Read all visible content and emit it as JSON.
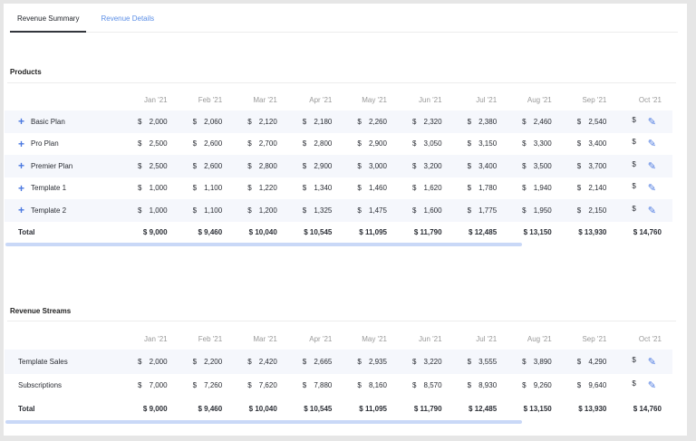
{
  "tabs": [
    {
      "label": "Revenue Summary",
      "active": true
    },
    {
      "label": "Revenue Details",
      "active": false
    }
  ],
  "months": [
    "Jan '21",
    "Feb '21",
    "Mar '21",
    "Apr '21",
    "May '21",
    "Jun '21",
    "Jul '21",
    "Aug '21",
    "Sep '21",
    "Oct '21"
  ],
  "currency": "$",
  "products": {
    "title": "Products",
    "rows": [
      {
        "label": "Basic Plan",
        "values": [
          "2,000",
          "2,060",
          "2,120",
          "2,180",
          "2,260",
          "2,320",
          "2,380",
          "2,460",
          "2,540"
        ]
      },
      {
        "label": "Pro Plan",
        "values": [
          "2,500",
          "2,600",
          "2,700",
          "2,800",
          "2,900",
          "3,050",
          "3,150",
          "3,300",
          "3,400"
        ]
      },
      {
        "label": "Premier Plan",
        "values": [
          "2,500",
          "2,600",
          "2,800",
          "2,900",
          "3,000",
          "3,200",
          "3,400",
          "3,500",
          "3,700"
        ]
      },
      {
        "label": "Template 1",
        "values": [
          "1,000",
          "1,100",
          "1,220",
          "1,340",
          "1,460",
          "1,620",
          "1,780",
          "1,940",
          "2,140"
        ]
      },
      {
        "label": "Template 2",
        "values": [
          "1,000",
          "1,100",
          "1,200",
          "1,325",
          "1,475",
          "1,600",
          "1,775",
          "1,950",
          "2,150"
        ]
      }
    ],
    "total": {
      "label": "Total",
      "values": [
        "$ 9,000",
        "$ 9,460",
        "$ 10,040",
        "$ 10,545",
        "$ 11,095",
        "$ 11,790",
        "$ 12,485",
        "$ 13,150",
        "$ 13,930",
        "$ 14,760"
      ]
    }
  },
  "streams": {
    "title": "Revenue Streams",
    "rows": [
      {
        "label": "Template Sales",
        "values": [
          "2,000",
          "2,200",
          "2,420",
          "2,665",
          "2,935",
          "3,220",
          "3,555",
          "3,890",
          "4,290"
        ]
      },
      {
        "label": "Subscriptions",
        "values": [
          "7,000",
          "7,260",
          "7,620",
          "7,880",
          "8,160",
          "8,570",
          "8,930",
          "9,260",
          "9,640"
        ]
      }
    ],
    "total": {
      "label": "Total",
      "values": [
        "$ 9,000",
        "$ 9,460",
        "$ 10,040",
        "$ 10,545",
        "$ 11,095",
        "$ 11,790",
        "$ 12,485",
        "$ 13,150",
        "$ 13,930",
        "$ 14,760"
      ]
    }
  }
}
